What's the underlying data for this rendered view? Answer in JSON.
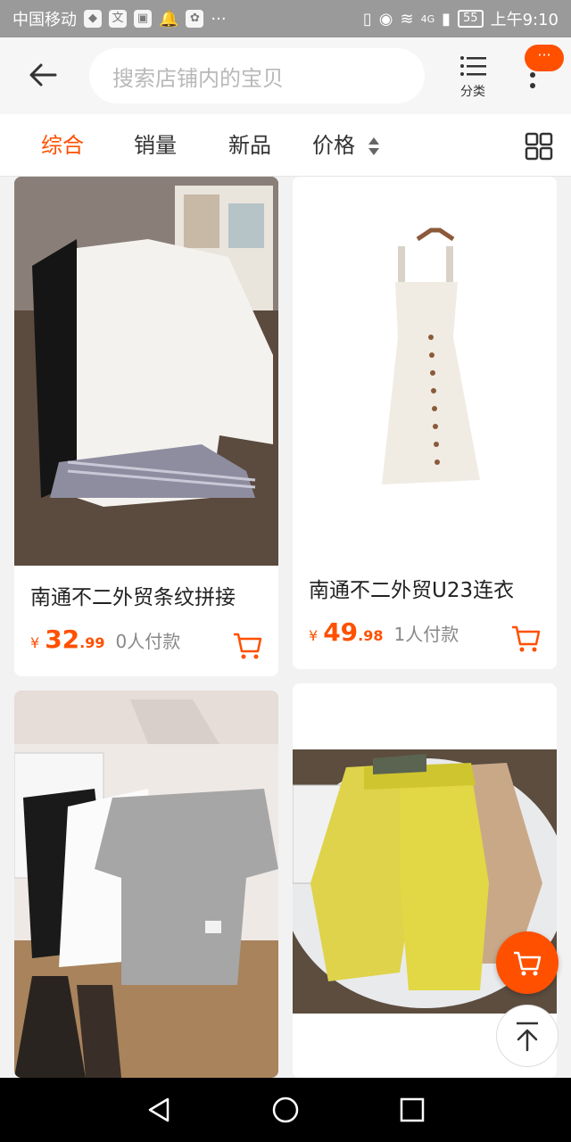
{
  "status_bar": {
    "carrier": "中国移动",
    "network": "4G",
    "battery": "55",
    "time": "上午9:10"
  },
  "header": {
    "search_placeholder": "搜索店铺内的宝贝",
    "category_label": "分类",
    "badge_text": "···"
  },
  "sort_tabs": [
    {
      "label": "综合",
      "active": true
    },
    {
      "label": "销量",
      "active": false
    },
    {
      "label": "新品",
      "active": false
    },
    {
      "label": "价格",
      "active": false
    }
  ],
  "products": [
    {
      "title": "南通不二外贸条纹拼接",
      "yen": "¥",
      "price_int": "32",
      "price_dec": ".99",
      "paid": "0人付款"
    },
    {
      "title": "南通不二外贸U23连衣",
      "yen": "¥",
      "price_int": "49",
      "price_dec": ".98",
      "paid": "1人付款"
    },
    {
      "title": "",
      "yen": "",
      "price_int": "",
      "price_dec": "",
      "paid": ""
    },
    {
      "title": "",
      "yen": "",
      "price_int": "",
      "price_dec": "",
      "paid": ""
    }
  ],
  "colors": {
    "accent": "#ff5000",
    "statusbar": "#9a9a9a"
  }
}
